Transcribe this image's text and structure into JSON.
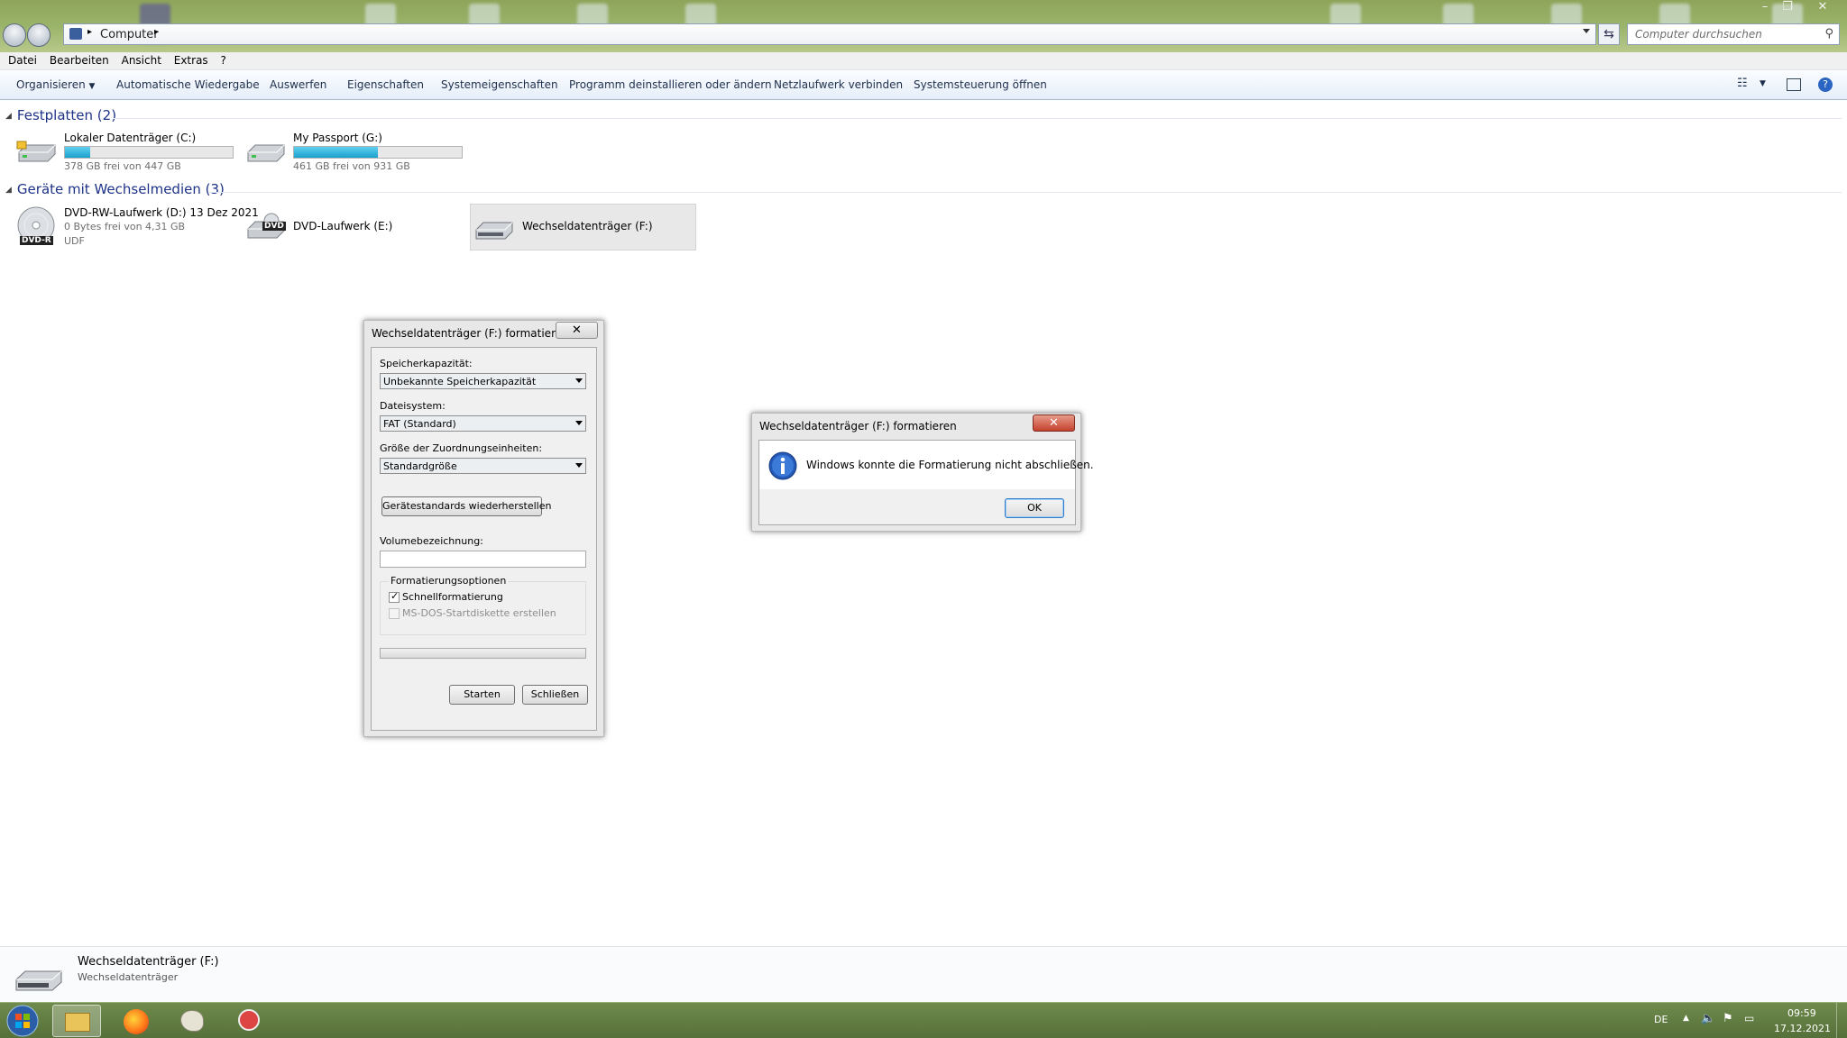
{
  "window": {
    "breadcrumb": "Computer",
    "search_placeholder": "Computer durchsuchen"
  },
  "menu": [
    "Datei",
    "Bearbeiten",
    "Ansicht",
    "Extras",
    "?"
  ],
  "toolbar": {
    "organize": "Organisieren",
    "items": [
      "Automatische Wiedergabe",
      "Auswerfen",
      "Eigenschaften",
      "Systemeigenschaften",
      "Programm deinstallieren oder ändern",
      "Netzlaufwerk verbinden",
      "Systemsteuerung öffnen"
    ]
  },
  "groups": {
    "hard_disks": {
      "title": "Festplatten (2)",
      "drives": [
        {
          "name": "Lokaler Datenträger (C:)",
          "free": "378 GB frei von 447 GB",
          "used_fraction": 0.15
        },
        {
          "name": "My Passport (G:)",
          "free": "461 GB frei von 931 GB",
          "used_fraction": 0.5
        }
      ]
    },
    "removable": {
      "title": "Geräte mit Wechselmedien (3)",
      "drives": [
        {
          "name": "DVD-RW-Laufwerk (D:) 13 Dez 2021",
          "free": "0 Bytes frei von 4,31 GB",
          "fs": "UDF",
          "badge": "DVD-R"
        },
        {
          "name": "DVD-Laufwerk (E:)",
          "badge": "DVD"
        },
        {
          "name": "Wechseldatenträger (F:)"
        }
      ]
    }
  },
  "format_dialog": {
    "title": "Wechseldatenträger (F:) formatieren",
    "capacity_label": "Speicherkapazität:",
    "capacity_value": "Unbekannte Speicherkapazität",
    "filesystem_label": "Dateisystem:",
    "filesystem_value": "FAT (Standard)",
    "alloc_label": "Größe der Zuordnungseinheiten:",
    "alloc_value": "Standardgröße",
    "restore_button": "Gerätestandards wiederherstellen",
    "volume_label": "Volumebezeichnung:",
    "volume_value": "",
    "options_title": "Formatierungsoptionen",
    "quick_format": "Schnellformatierung",
    "quick_format_checked": true,
    "msdos": "MS-DOS-Startdiskette erstellen",
    "msdos_checked": false,
    "progress": 0,
    "start_button": "Starten",
    "close_button": "Schließen"
  },
  "message_dialog": {
    "title": "Wechseldatenträger (F:) formatieren",
    "message": "Windows konnte die Formatierung nicht abschließen.",
    "ok_button": "OK"
  },
  "details_pane": {
    "name": "Wechseldatenträger (F:)",
    "type": "Wechseldatenträger"
  },
  "taskbar": {
    "lang": "DE",
    "time": "09:59",
    "date": "17.12.2021"
  },
  "colors": {
    "group_header": "#1e3287",
    "disk_bar": "#26a9d6",
    "taskbar": "#5f7a42"
  }
}
